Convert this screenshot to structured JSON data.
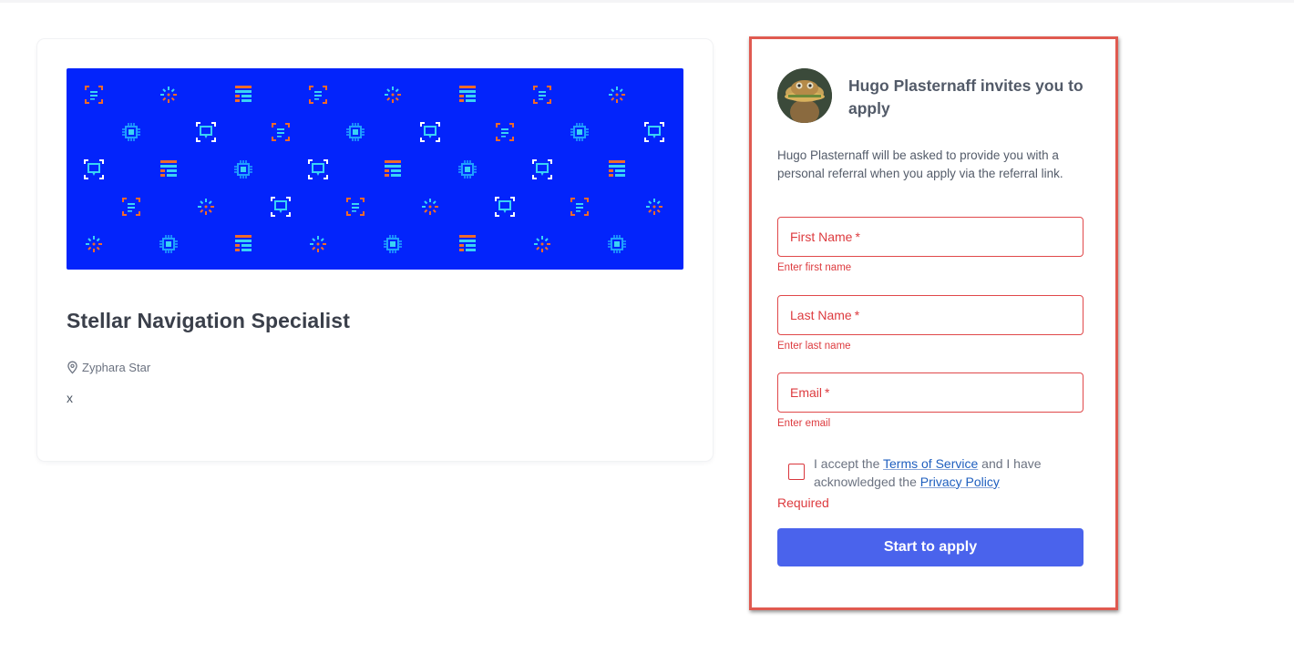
{
  "job": {
    "title": "Stellar Navigation Specialist",
    "location": "Zyphara Star",
    "description": "x",
    "banner_color": "#0324fb",
    "location_icon": "map-pin-icon"
  },
  "referral": {
    "title": "Hugo Plasternaff invites you to apply",
    "message": "Hugo Plasternaff will be asked to provide you with a personal referral when you apply via the referral link.",
    "avatar": "referrer-avatar"
  },
  "form": {
    "first_name": {
      "label": "First Name",
      "required_mark": "*",
      "error": "Enter first name"
    },
    "last_name": {
      "label": "Last Name",
      "required_mark": "*",
      "error": "Enter last name"
    },
    "email": {
      "label": "Email",
      "required_mark": "*",
      "error": "Enter email"
    },
    "terms": {
      "prefix": "I accept the ",
      "tos_link": "Terms of Service",
      "middle": " and I have acknowledged the ",
      "privacy_link": "Privacy Policy",
      "checked": false
    },
    "required_text": "Required",
    "submit_label": "Start to apply"
  },
  "colors": {
    "error": "#dd3b3f",
    "primary_button": "#4a63ec",
    "link": "#1f5fbf",
    "highlight_border": "#e05a50"
  }
}
